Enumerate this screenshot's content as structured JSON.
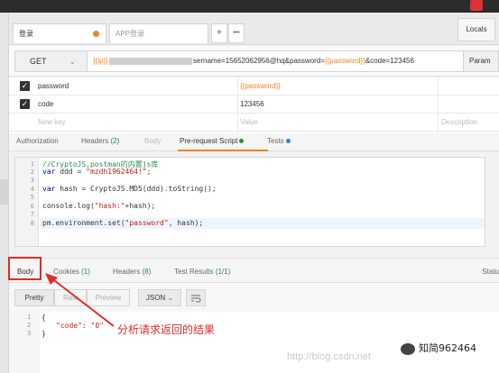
{
  "tabs": {
    "tab1_label": "登录",
    "tab2_label": "APP登录",
    "add_label": "+",
    "more_label": "•••",
    "env_label": "Locals"
  },
  "request": {
    "method": "GET",
    "url_var": "{{ip}}",
    "url_rest_1": "sername=15652062956@hq&password=",
    "url_var2": "{{password}}",
    "url_rest_2": "&code=123456",
    "params_label": "Param"
  },
  "params_table": {
    "rows": [
      {
        "key": "password",
        "value": "{{password}}"
      },
      {
        "key": "code",
        "value": "123456"
      }
    ],
    "new_key_placeholder": "New key",
    "value_placeholder": "Value",
    "description_placeholder": "Description"
  },
  "request_tabs": {
    "authorization": "Authorization",
    "headers": "Headers",
    "headers_count": "(2)",
    "body": "Body",
    "prerequest": "Pre-request Script",
    "tests": "Tests"
  },
  "script": {
    "line_numbers": [
      "1",
      "2",
      "3",
      "4",
      "5",
      "6",
      "7",
      "8"
    ],
    "line1": "//CryptoJS,postman的内置js库",
    "line2_kw": "var",
    "line2_rest": " ddd = ",
    "line2_str": "\"mzdh1962464!\"",
    "line2_end": ";",
    "line4_kw": "var",
    "line4_rest": " hash = CryptoJS.MD5(ddd).toString();",
    "line6_a": "console.log(",
    "line6_str": "\"hash:\"",
    "line6_b": "+hash);",
    "line8_a": "pm.environment.set(",
    "line8_str": "\"password\"",
    "line8_b": ", hash);"
  },
  "response_tabs": {
    "body": "Body",
    "cookies": "Cookies",
    "cookies_count": "(1)",
    "headers": "Headers",
    "headers_count": "(8)",
    "test_results": "Test Results",
    "test_count": "(1/1)",
    "status_label": "Statu"
  },
  "response_tools": {
    "pretty": "Pretty",
    "raw": "Raw",
    "preview": "Preview",
    "format": "JSON"
  },
  "response": {
    "line_numbers": [
      "1",
      "2",
      "3"
    ],
    "line1": "{",
    "line2_key": "\"code\"",
    "line2_sep": ": ",
    "line2_val": "\"0\"",
    "line3": "}"
  },
  "annotation": "分析请求返回的结果",
  "watermark": "http://blog.csdn.net",
  "wechat": "知简962464",
  "colors": {
    "accent": "#f4811f",
    "highlight": "#e02b2b",
    "count_green": "#2b8a3e"
  }
}
